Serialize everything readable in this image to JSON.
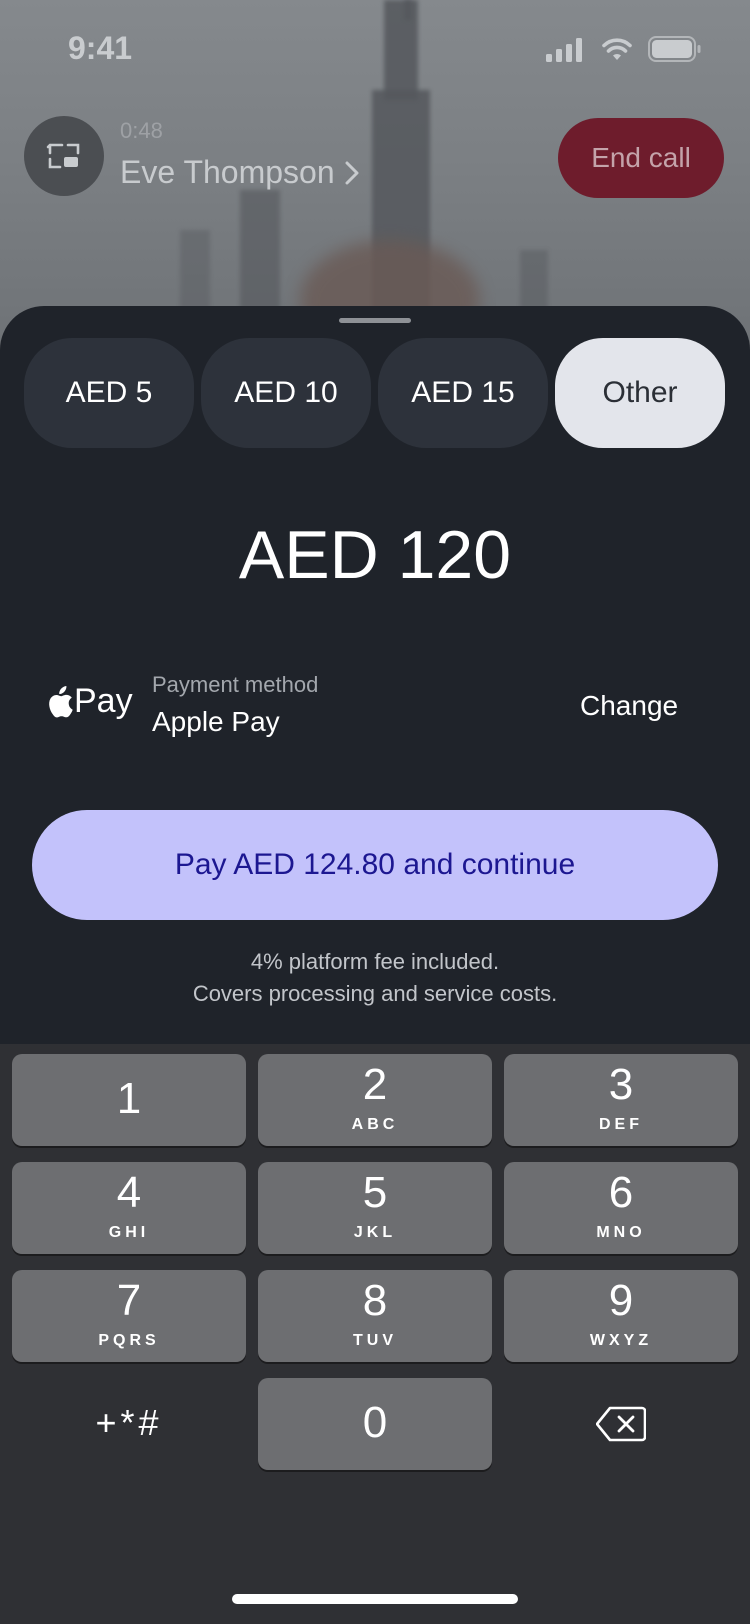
{
  "status_bar": {
    "time": "9:41"
  },
  "call": {
    "duration": "0:48",
    "name": "Eve Thompson",
    "end_call_label": "End call"
  },
  "tip_options": [
    {
      "label": "AED 5",
      "selected": false
    },
    {
      "label": "AED 10",
      "selected": false
    },
    {
      "label": "AED 15",
      "selected": false
    },
    {
      "label": "Other",
      "selected": true
    }
  ],
  "amount": "AED 120",
  "payment": {
    "logo_text": "Pay",
    "label": "Payment method",
    "value": "Apple Pay",
    "change_label": "Change"
  },
  "pay_button_label": "Pay AED 124.80 and continue",
  "fee_note": {
    "line1": "4% platform fee included.",
    "line2": "Covers processing and service costs."
  },
  "keypad": {
    "keys": [
      {
        "num": "1",
        "letters": ""
      },
      {
        "num": "2",
        "letters": "ABC"
      },
      {
        "num": "3",
        "letters": "DEF"
      },
      {
        "num": "4",
        "letters": "GHI"
      },
      {
        "num": "5",
        "letters": "JKL"
      },
      {
        "num": "6",
        "letters": "MNO"
      },
      {
        "num": "7",
        "letters": "PQRS"
      },
      {
        "num": "8",
        "letters": "TUV"
      },
      {
        "num": "9",
        "letters": "WXYZ"
      },
      {
        "num": "0",
        "letters": ""
      }
    ],
    "symbols": "+*#"
  },
  "colors": {
    "sheet_bg": "#1f232a",
    "pay_button": "#c3c2fb",
    "pay_button_text": "#1c1791",
    "end_call": "#6e1c2c"
  }
}
